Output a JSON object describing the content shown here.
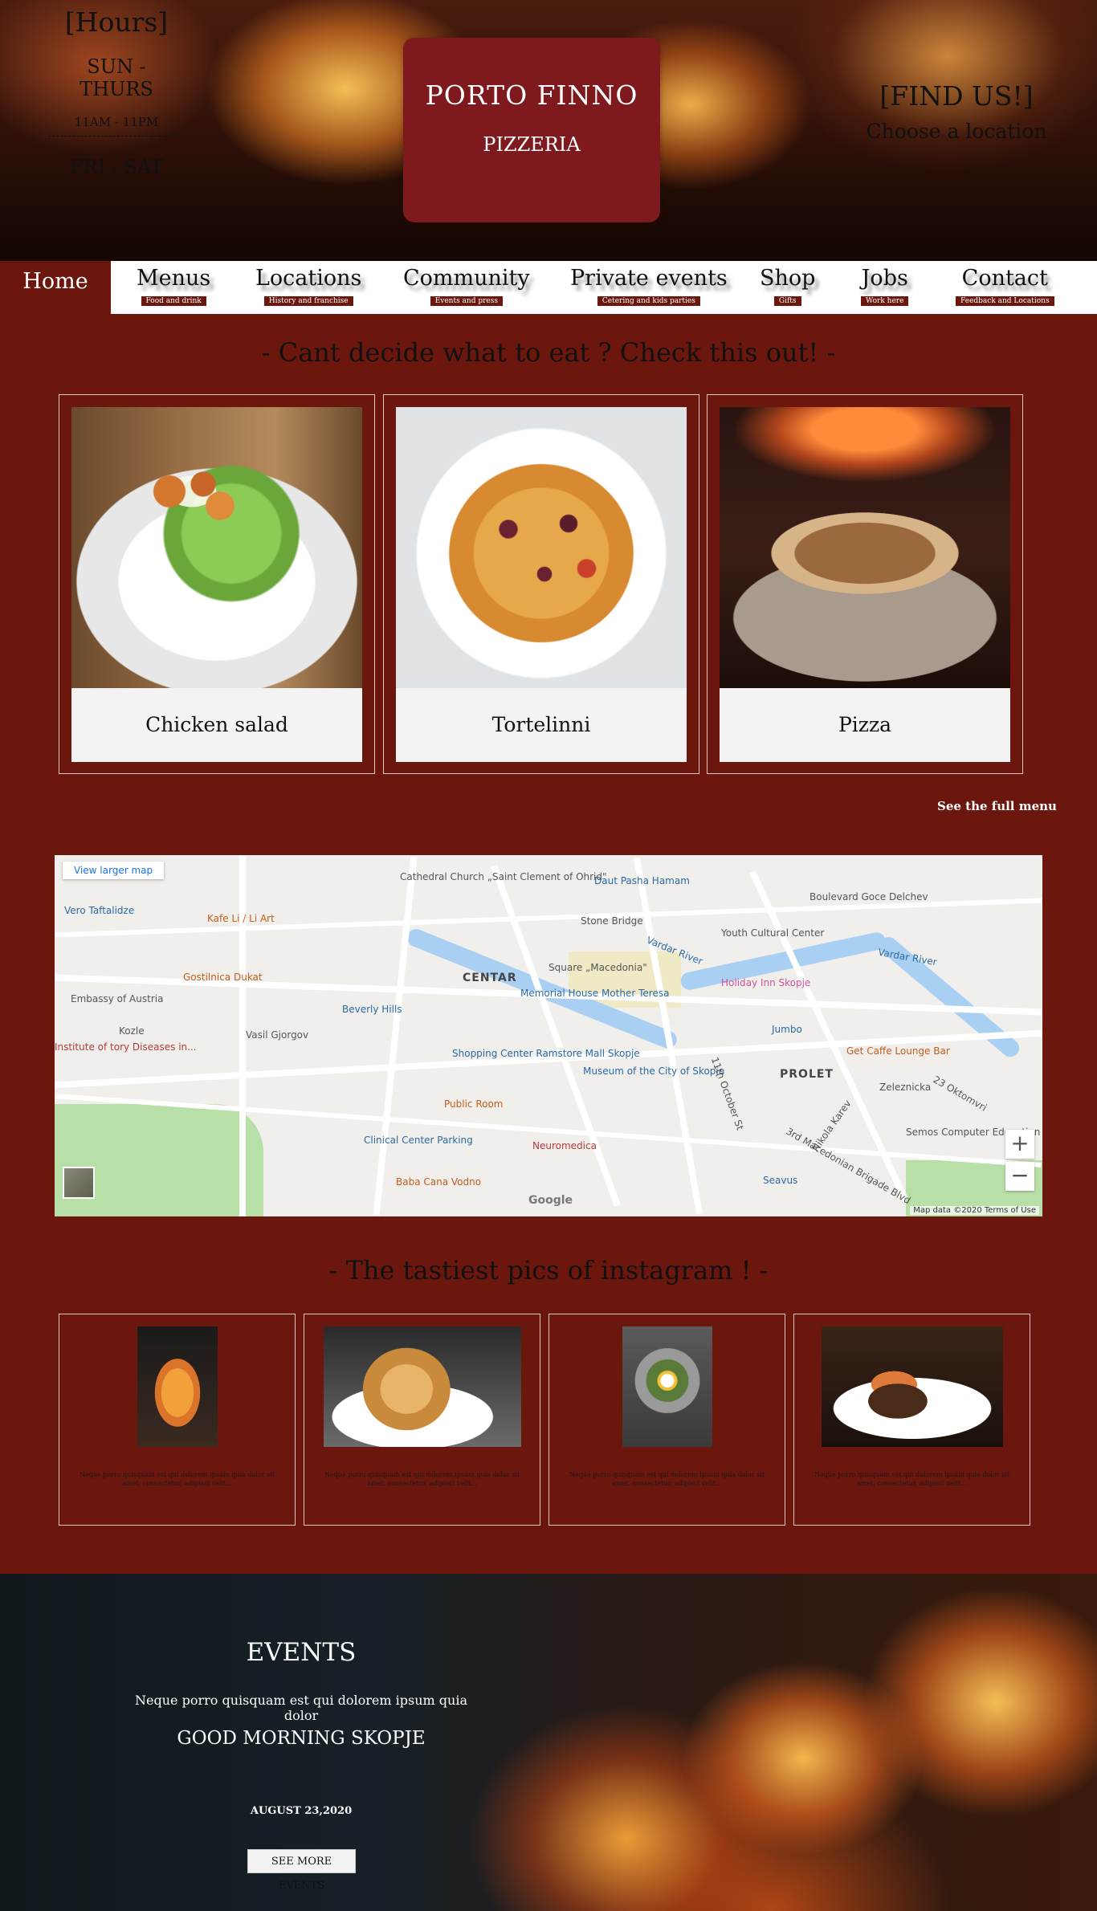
{
  "hero": {
    "hours_title": "[Hours]",
    "hours_days_1": "SUN - THURS",
    "hours_time": "11AM - 11PM",
    "hours_days_2": "FRI - SAT",
    "logo_name": "PORTO FINNO",
    "logo_sub": "PIZZERIA",
    "find_title": "[FIND US!]",
    "find_sub": "Choose a location"
  },
  "nav": {
    "home": "Home",
    "items": [
      {
        "label": "Menus",
        "sub": "Food and drink"
      },
      {
        "label": "Locations",
        "sub": "History and franchise"
      },
      {
        "label": "Community",
        "sub": "Events and press"
      },
      {
        "label": "Private events",
        "sub": "Cetering and kids parties"
      },
      {
        "label": "Shop",
        "sub": "Gifts"
      },
      {
        "label": "Jobs",
        "sub": "Work here"
      },
      {
        "label": "Contact",
        "sub": "Feedback and Locations"
      }
    ]
  },
  "menu_section": {
    "title": "- Cant decide what to eat ? Check this out! -",
    "cards": [
      {
        "label": "Chicken salad"
      },
      {
        "label": "Tortelinni"
      },
      {
        "label": "Pizza"
      }
    ],
    "see_full_menu": "See the full menu"
  },
  "map": {
    "larger_map": "View larger map",
    "zoom_in": "+",
    "zoom_out": "−",
    "footer": "Map data ©2020   Terms of Use",
    "google": "Google",
    "labels": {
      "cathedral": "Cathedral Church „Saint Clement of Ohrid\"",
      "daut_pasha": "Daut Pasha Hamam",
      "vero": "Vero Taftalidze",
      "kafe": "Kafe Li / Li Art",
      "stone_bridge": "Stone Bridge",
      "youth_center": "Youth Cultural Center",
      "gostilnica": "Gostilnica Dukat",
      "square": "Square „Macedonia\"",
      "centar": "CENTAR",
      "embassy": "Embassy of Austria",
      "memorial": "Memorial House Mother Teresa",
      "beverly": "Beverly Hills",
      "holiday_inn": "Holiday Inn Skopje",
      "vardar": "Vardar River",
      "jumbo": "Jumbo",
      "get_caffe": "Get Caffe Lounge Bar",
      "prolet": "PROLET",
      "zeleznicka": "Zeleznicka",
      "shopping": "Shopping Center Ramstore Mall Skopje",
      "museum": "Museum of the City of Skopje",
      "public_room": "Public Room",
      "clinical": "Clinical Center Parking",
      "neuromedica": "Neuromedica",
      "semos": "Semos Computer Education Center",
      "baba_cana": "Baba Cana Vodno",
      "seavus": "Seavus",
      "institute": "Institute of tory Diseases in...",
      "vasil": "Vasil Gjorgov",
      "kozle": "Kozle",
      "eleventh": "11th October St",
      "third_mac": "3rd Macedonian Brigade Blvd",
      "nikola_karev": "Nikola Karev",
      "boulevard": "Boulevard Goce Delchev",
      "oktomvri": "23 Oktomvri"
    }
  },
  "instagram": {
    "title": "- The tastiest pics of instagram ! -",
    "posts": [
      {
        "text": "Neque porro quisquam est qui dolorem ipsum quia dolor sit amet, consectetur, adipisci velit..."
      },
      {
        "text": "Neque porro quisquam est qui dolorem ipsum quia dolor sit amet, consectetur, adipisci velit..."
      },
      {
        "text": "Neque porro quisquam est qui dolorem ipsum quia dolor sit amet, consectetur, adipisci velit..."
      },
      {
        "text": "Neque porro quisquam est qui dolorem ipsum quia dolor sit amet, consectetur, adipisci velit..."
      }
    ]
  },
  "events": {
    "title": "EVENTS",
    "description": "Neque porro quisquam est qui dolorem ipsum quia dolor",
    "event_name": "GOOD MORNING SKOPJE",
    "date": "AUGUST 23,2020",
    "button": "SEE MORE EVENTS"
  },
  "colors": {
    "maroon": "#6b170d",
    "logo_red": "#7e1a1d"
  }
}
